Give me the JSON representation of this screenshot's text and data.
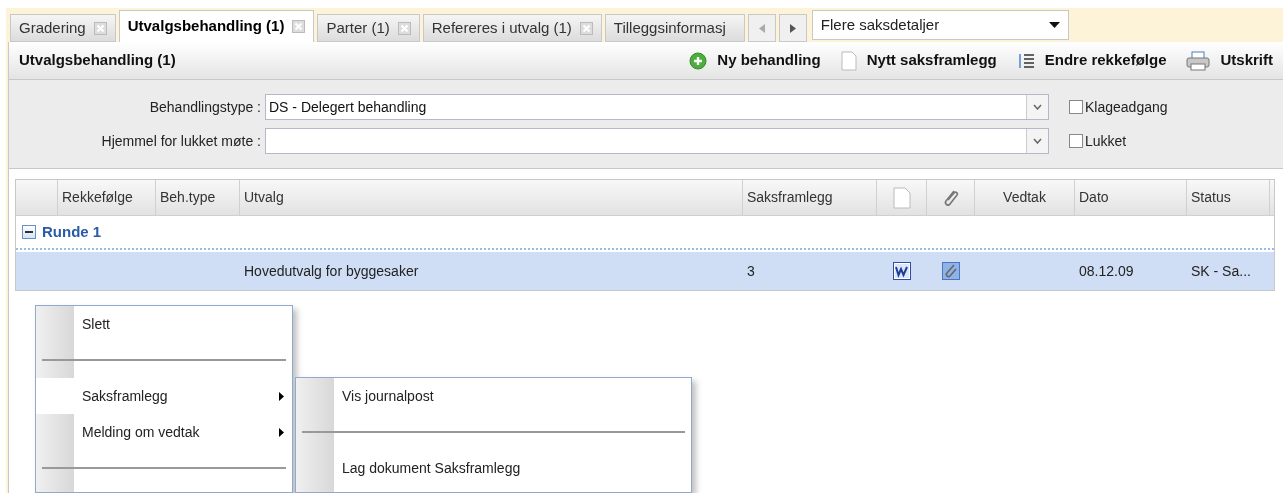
{
  "tabs": [
    {
      "label": "Gradering",
      "selected": false,
      "closable": true
    },
    {
      "label": "Utvalgsbehandling (1)",
      "selected": true,
      "closable": true
    },
    {
      "label": "Parter (1)",
      "selected": false,
      "closable": true
    },
    {
      "label": "Refereres i utvalg (1)",
      "selected": false,
      "closable": true
    },
    {
      "label": "Tilleggsinformasj",
      "selected": false,
      "closable": false
    }
  ],
  "more_dropdown": {
    "value": "Flere saksdetaljer"
  },
  "panel_title": "Utvalgsbehandling (1)",
  "toolbar": [
    {
      "kind": "add",
      "label": "Ny behandling"
    },
    {
      "kind": "document",
      "label": "Nytt saksframlegg"
    },
    {
      "kind": "order",
      "label": "Endre rekkefølge"
    },
    {
      "kind": "print",
      "label": "Utskrift"
    }
  ],
  "form": [
    {
      "label": "Behandlingstype :",
      "value": "DS - Delegert behandling",
      "checkbox": {
        "label": "Klageadgang",
        "checked": false
      }
    },
    {
      "label": "Hjemmel for lukket møte :",
      "checkbox": {
        "label": "Lukket",
        "checked": false
      }
    }
  ],
  "table": {
    "columns": [
      {
        "kind": "blank"
      },
      {
        "kind": "text",
        "label": "Rekkefølge"
      },
      {
        "kind": "text",
        "label": "Beh.type"
      },
      {
        "kind": "text",
        "label": "Utvalg"
      },
      {
        "kind": "text",
        "label": "Saksframlegg"
      },
      {
        "kind": "document"
      },
      {
        "kind": "attachment"
      },
      {
        "kind": "text",
        "label": "Vedtak"
      },
      {
        "kind": "text",
        "label": "Dato"
      },
      {
        "kind": "text",
        "label": "Status"
      }
    ],
    "group": {
      "label": "Runde 1",
      "expanded": true
    },
    "rows": [
      {
        "selected": true,
        "cells": [
          {
            "kind": "blank"
          },
          {
            "kind": "blank"
          },
          {
            "kind": "blank"
          },
          {
            "kind": "text",
            "text": "Hovedutvalg for byggesaker"
          },
          {
            "kind": "text",
            "text": "3"
          },
          {
            "kind": "word"
          },
          {
            "kind": "attachment"
          },
          {
            "kind": "blank"
          },
          {
            "kind": "text",
            "text": "08.12.09"
          },
          {
            "kind": "text",
            "text": "SK - Sa..."
          }
        ]
      }
    ]
  },
  "context_menu": [
    {
      "kind": "item",
      "label": "Slett",
      "selected": false,
      "submenu": false
    },
    {
      "kind": "separator"
    },
    {
      "kind": "item",
      "label": "Saksframlegg",
      "selected": true,
      "submenu": true
    },
    {
      "kind": "item",
      "label": "Melding om vedtak",
      "selected": false,
      "submenu": true
    },
    {
      "kind": "separator"
    }
  ],
  "submenu": [
    {
      "kind": "item",
      "label": "Vis journalpost"
    },
    {
      "kind": "separator"
    },
    {
      "kind": "item",
      "label": "Lag dokument Saksframlegg"
    }
  ]
}
